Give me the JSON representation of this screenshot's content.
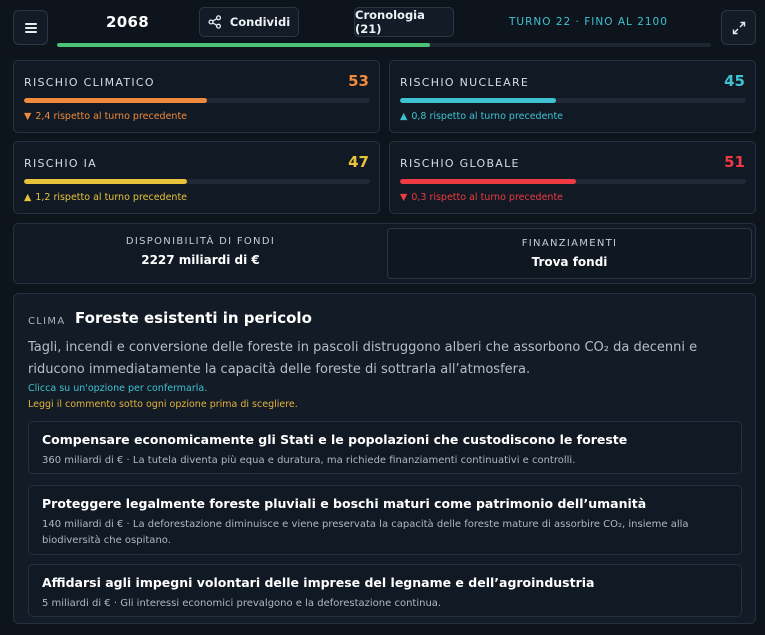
{
  "header": {
    "year": "2068",
    "share_label": "Condividi",
    "history_label": "Cronologia (21)",
    "turn_label": "TURNO 22 · FINO AL 2100",
    "progress_fraction": 0.57,
    "icons": {
      "menu": "menu-icon",
      "share": "share-icon",
      "expand": "expand-icon"
    },
    "progress_color": "#4cc275"
  },
  "risks": [
    {
      "label": "RISCHIO CLIMATICO",
      "value": "53",
      "fraction": 0.53,
      "color": "#f08a3c",
      "delta_arrow": "▼",
      "delta_text": "2,4 rispetto al turno precedente",
      "delta_color": "#f08a3c"
    },
    {
      "label": "RISCHIO NUCLEARE",
      "value": "45",
      "fraction": 0.45,
      "color": "#3ec1d0",
      "delta_arrow": "▲",
      "delta_text": "0,8 rispetto al turno precedente",
      "delta_color": "#3ec1d0"
    },
    {
      "label": "RISCHIO IA",
      "value": "47",
      "fraction": 0.47,
      "color": "#e8c23a",
      "delta_arrow": "▲",
      "delta_text": "1,2 rispetto al turno precedente",
      "delta_color": "#e8c23a"
    },
    {
      "label": "RISCHIO GLOBALE",
      "value": "51",
      "fraction": 0.51,
      "color": "#ee3a40",
      "delta_arrow": "▼",
      "delta_text": "0,3 rispetto al turno precedente",
      "delta_color": "#ee3a40"
    }
  ],
  "funds": {
    "label": "DISPONIBILITÀ DI FONDI",
    "value": "2227 miliardi di €"
  },
  "financing": {
    "label": "FINANZIAMENTI",
    "button_label": "Trova fondi"
  },
  "event": {
    "category": "CLIMA",
    "title": "Foreste esistenti in pericolo",
    "description": "Tagli, incendi e conversione delle foreste in pascoli distruggono alberi che assorbono CO₂ da decenni e riducono immediatamente la capacità delle foreste di sottrarla all’atmosfera.",
    "hint_click": "Clicca su un'opzione per confermarla.",
    "hint_read": "Leggi il commento sotto ogni opzione prima di scegliere.",
    "options": [
      {
        "title": "Compensare economicamente gli Stati e le popolazioni che custodiscono le foreste",
        "description": "360 miliardi di € · La tutela diventa più equa e duratura, ma richiede finanziamenti continuativi e controlli."
      },
      {
        "title": "Proteggere legalmente foreste pluviali e boschi maturi come patrimonio dell’umanità",
        "description": "140 miliardi di € · La deforestazione diminuisce e viene preservata la capacità delle foreste mature di assorbire CO₂, insieme alla biodiversità che ospitano."
      },
      {
        "title": "Affidarsi agli impegni volontari delle imprese del legname e dell’agroindustria",
        "description": "5 miliardi di € · Gli interessi economici prevalgono e la deforestazione continua."
      }
    ]
  }
}
